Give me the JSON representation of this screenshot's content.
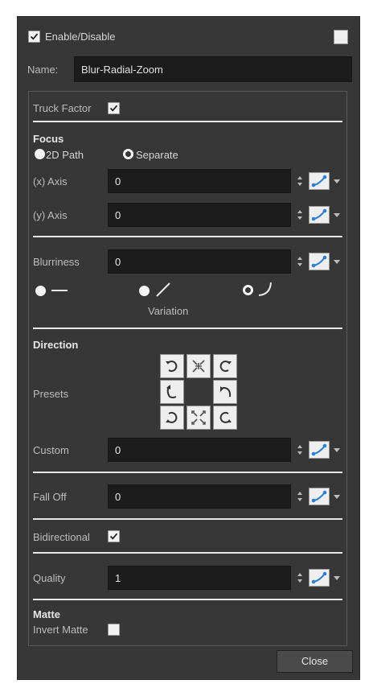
{
  "header": {
    "enable_label": "Enable/Disable",
    "enable_checked": true,
    "name_label": "Name:",
    "name_value": "Blur-Radial-Zoom"
  },
  "truck_factor": {
    "label": "Truck Factor",
    "checked": true
  },
  "focus": {
    "title": "Focus",
    "option_2d_path": "2D Path",
    "option_separate": "Separate",
    "selected": "Separate",
    "x_axis_label": "(x) Axis",
    "x_axis_value": "0",
    "y_axis_label": "(y) Axis",
    "y_axis_value": "0"
  },
  "blurriness": {
    "label": "Blurriness",
    "value": "0",
    "variation_label": "Variation"
  },
  "direction": {
    "title": "Direction",
    "presets_label": "Presets",
    "custom_label": "Custom",
    "custom_value": "0"
  },
  "fall_off": {
    "label": "Fall Off",
    "value": "0"
  },
  "bidirectional": {
    "label": "Bidirectional",
    "checked": true
  },
  "quality": {
    "label": "Quality",
    "value": "1"
  },
  "matte": {
    "title": "Matte",
    "invert_label": "Invert Matte",
    "invert_checked": false
  },
  "footer": {
    "close_label": "Close"
  },
  "icons": {
    "function_curve": "function-curve-icon",
    "spinner": "spinner-arrows-icon"
  },
  "colors": {
    "panel_bg": "#373737",
    "field_bg": "#1c1c1c",
    "curve_blue": "#2c7fd6"
  }
}
